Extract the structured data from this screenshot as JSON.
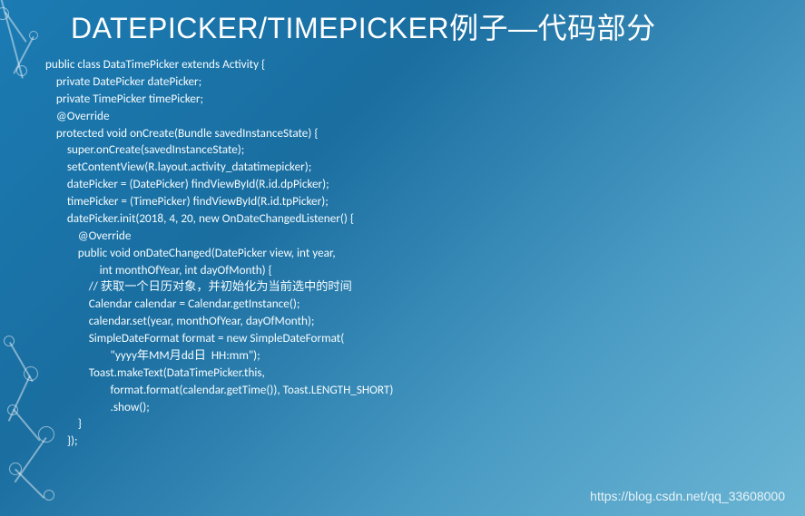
{
  "title": "DATEPICKER/TIMEPICKER例子—代码部分",
  "code": {
    "l1": "public class DataTimePicker extends Activity {",
    "l2": "    private DatePicker datePicker;",
    "l3": "    private TimePicker timePicker;",
    "l4": "    @Override",
    "l5": "    protected void onCreate(Bundle savedInstanceState) {",
    "l6": "        super.onCreate(savedInstanceState);",
    "l7": "        setContentView(R.layout.activity_datatimepicker);",
    "l8": "",
    "l9": "        datePicker = (DatePicker) findViewById(R.id.dpPicker);",
    "l10": "        timePicker = (TimePicker) findViewById(R.id.tpPicker);",
    "l11": "",
    "l12": "        datePicker.init(2018, 4, 20, new OnDateChangedListener() {",
    "l13": "",
    "l14": "            @Override",
    "l15": "            public void onDateChanged(DatePicker view, int year,",
    "l16": "                    int monthOfYear, int dayOfMonth) {",
    "l17": "                // 获取一个日历对象，并初始化为当前选中的时间",
    "l18": "                Calendar calendar = Calendar.getInstance();",
    "l19": "                calendar.set(year, monthOfYear, dayOfMonth);",
    "l20": "                SimpleDateFormat format = new SimpleDateFormat(",
    "l21": "                        \"yyyy年MM月dd日  HH:mm\");",
    "l22": "                Toast.makeText(DataTimePicker.this,",
    "l23": "                        format.format(calendar.getTime()), Toast.LENGTH_SHORT)",
    "l24": "                        .show();",
    "l25": "",
    "l26": "            }",
    "l27": "        });"
  },
  "watermark": "https://blog.csdn.net/qq_33608000"
}
